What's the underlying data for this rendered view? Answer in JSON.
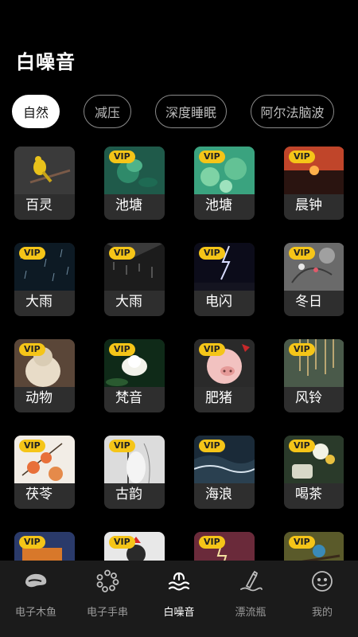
{
  "title": "白噪音",
  "categories": [
    {
      "label": "自然",
      "active": true
    },
    {
      "label": "减压",
      "active": false
    },
    {
      "label": "深度睡眠",
      "active": false
    },
    {
      "label": "阿尔法脑波",
      "active": false
    }
  ],
  "vip_badge": "VIP",
  "sounds": [
    {
      "label": "百灵",
      "vip": false,
      "scene": "bird"
    },
    {
      "label": "池塘",
      "vip": true,
      "scene": "pond1"
    },
    {
      "label": "池塘",
      "vip": true,
      "scene": "pond2"
    },
    {
      "label": "晨钟",
      "vip": true,
      "scene": "sunrise"
    },
    {
      "label": "大雨",
      "vip": true,
      "scene": "rain1"
    },
    {
      "label": "大雨",
      "vip": true,
      "scene": "rain2"
    },
    {
      "label": "电闪",
      "vip": true,
      "scene": "lightning"
    },
    {
      "label": "冬日",
      "vip": true,
      "scene": "winter"
    },
    {
      "label": "动物",
      "vip": true,
      "scene": "cat"
    },
    {
      "label": "梵音",
      "vip": true,
      "scene": "lotus"
    },
    {
      "label": "肥猪",
      "vip": true,
      "scene": "pig"
    },
    {
      "label": "风铃",
      "vip": true,
      "scene": "chimes"
    },
    {
      "label": "茯苓",
      "vip": true,
      "scene": "flower"
    },
    {
      "label": "古韵",
      "vip": true,
      "scene": "ancient"
    },
    {
      "label": "海浪",
      "vip": true,
      "scene": "waves"
    },
    {
      "label": "喝茶",
      "vip": true,
      "scene": "tea"
    },
    {
      "label": "",
      "vip": true,
      "scene": "boat"
    },
    {
      "label": "",
      "vip": true,
      "scene": "rooster"
    },
    {
      "label": "",
      "vip": true,
      "scene": "storm"
    },
    {
      "label": "",
      "vip": true,
      "scene": "birdbranch"
    }
  ],
  "tabs": [
    {
      "label": "电子木鱼",
      "icon": "wooden-fish-icon",
      "active": false
    },
    {
      "label": "电子手串",
      "icon": "bead-bracelet-icon",
      "active": false
    },
    {
      "label": "白噪音",
      "icon": "wave-sound-icon",
      "active": true
    },
    {
      "label": "漂流瓶",
      "icon": "drift-bottle-icon",
      "active": false
    },
    {
      "label": "我的",
      "icon": "smiley-face-icon",
      "active": false
    }
  ],
  "colors": {
    "accent": "#f5c518",
    "background": "#000000",
    "tabbar": "#1b1b1b",
    "card": "#2e2e2e"
  }
}
